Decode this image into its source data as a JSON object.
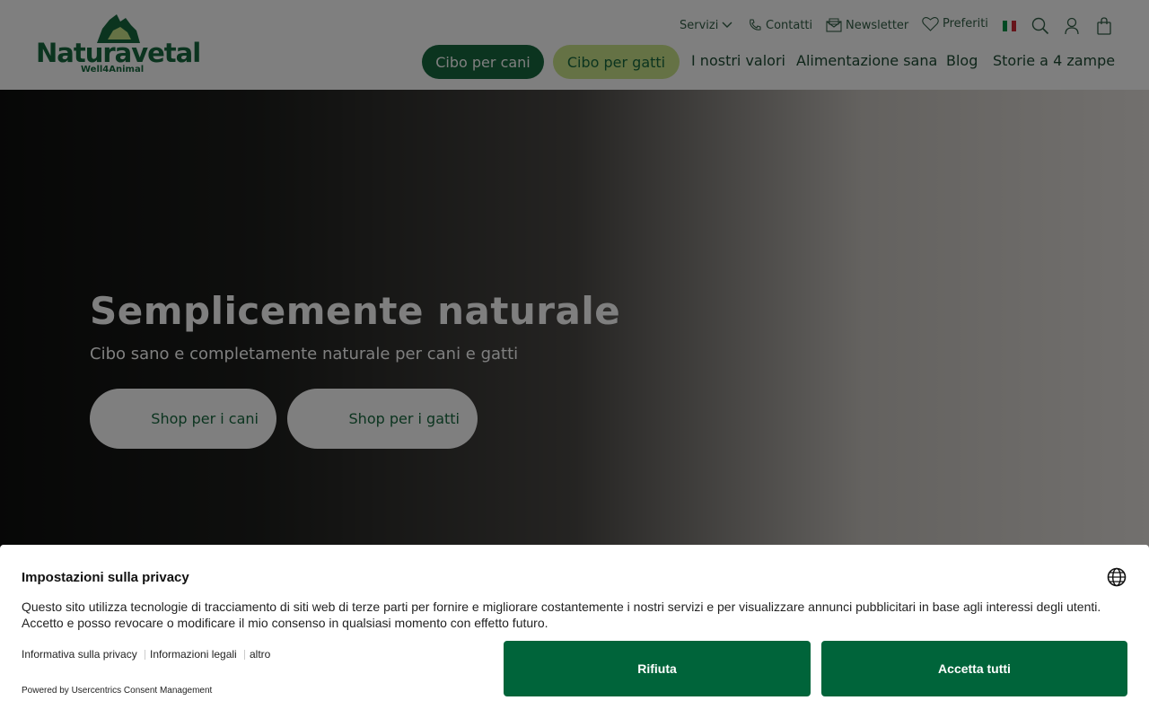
{
  "brand": {
    "name": "Naturavetal",
    "tagline": "Well4Animal",
    "color_primary": "#17683e",
    "color_accent": "#cbe58a"
  },
  "header": {
    "utility": {
      "services_label": "Servizi",
      "contacts_label": "Contatti",
      "newsletter_label": "Newsletter",
      "favorites_label": "Preferiti",
      "language_flag": "flag-italy-icon",
      "icons": [
        "search-icon",
        "user-icon",
        "shopping-bag-icon"
      ]
    },
    "nav": {
      "dog_food": "Cibo per cani",
      "cat_food": "Cibo per gatti",
      "values": "I nostri valori",
      "healthy_food": "Alimentazione sana",
      "blog": "Blog",
      "stories": "Storie a 4 zampe"
    }
  },
  "hero": {
    "title": "Semplicemente naturale",
    "subtitle": "Cibo sano e completamente naturale per cani e gatti",
    "shop_dogs": "Shop per i cani",
    "shop_cats": "Shop per i gatti"
  },
  "consent": {
    "title": "Impostazioni sulla privacy",
    "body_line1": "Questo sito utilizza tecnologie di tracciamento di siti web di terze parti per fornire e migliorare costantemente i nostri servizi e per visualizzare annunci pubblicitari in base agli interessi degli utenti.",
    "body_line2": "Accetto e posso revocare o modificare il mio consenso in qualsiasi momento con effetto futuro.",
    "link_privacy": "Informativa sulla privacy",
    "link_legal": "Informazioni legali",
    "link_more": "altro",
    "powered_by": "Powered by Usercentrics Consent Management",
    "reject_label": "Rifiuta",
    "accept_label": "Accetta tutti",
    "button_color": "#00643a"
  }
}
